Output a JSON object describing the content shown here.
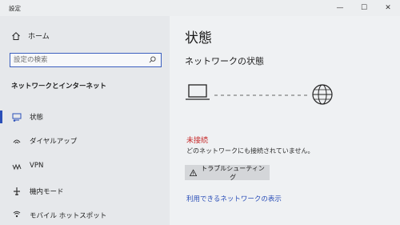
{
  "app": {
    "title": "設定"
  },
  "window_controls": {
    "minimize": "—",
    "maximize": "☐",
    "close": "✕"
  },
  "sidebar": {
    "home_label": "ホーム",
    "search_placeholder": "設定の検索",
    "section_header": "ネットワークとインターネット",
    "items": [
      {
        "label": "状態",
        "icon": "status-icon",
        "selected": true
      },
      {
        "label": "ダイヤルアップ",
        "icon": "dialup-icon",
        "selected": false
      },
      {
        "label": "VPN",
        "icon": "vpn-icon",
        "selected": false
      },
      {
        "label": "機内モード",
        "icon": "airplane-icon",
        "selected": false
      },
      {
        "label": "モバイル ホットスポット",
        "icon": "hotspot-icon",
        "selected": false
      }
    ]
  },
  "main": {
    "page_title": "状態",
    "network_status_heading": "ネットワークの状態",
    "connection_status": "未接続",
    "connection_description": "どのネットワークにも接続されていません。",
    "troubleshoot_label": "トラブルシューティング",
    "available_networks_link": "利用できるネットワークの表示"
  },
  "colors": {
    "accent": "#2b4fb8",
    "error": "#c62828",
    "sidebar_bg": "#e6e8eb",
    "content_bg": "#eff1f3"
  }
}
